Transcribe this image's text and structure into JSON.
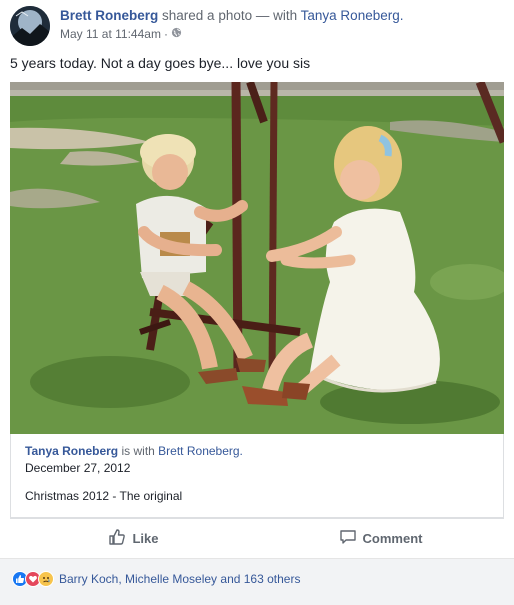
{
  "post": {
    "author": "Brett Roneberg",
    "action": "shared a photo",
    "with_prefix": "— with",
    "tagged": "Tanya Roneberg.",
    "timestamp": "May 11 at 11:44am",
    "separator": "·",
    "audience_icon": "globe-icon",
    "status_text": "5 years today. Not a day goes bye... love you sis"
  },
  "attachment": {
    "author": "Tanya Roneberg",
    "is_with": "is with",
    "with_name": "Brett Roneberg.",
    "date": "December 27, 2012",
    "caption": "Christmas 2012 - The original"
  },
  "actions": {
    "like_label": "Like",
    "comment_label": "Comment",
    "like_icon": "thumbs-up-icon",
    "comment_icon": "comment-bubble-icon"
  },
  "reactions": {
    "icons": [
      "like-reaction-icon",
      "love-reaction-icon",
      "sad-reaction-icon"
    ],
    "text": "Barry Koch, Michelle Moseley and 163 others"
  },
  "colors": {
    "link": "#365899",
    "like_blue": "#1877f2",
    "love_red": "#e4475b",
    "sad_yellow": "#f7c44d"
  }
}
